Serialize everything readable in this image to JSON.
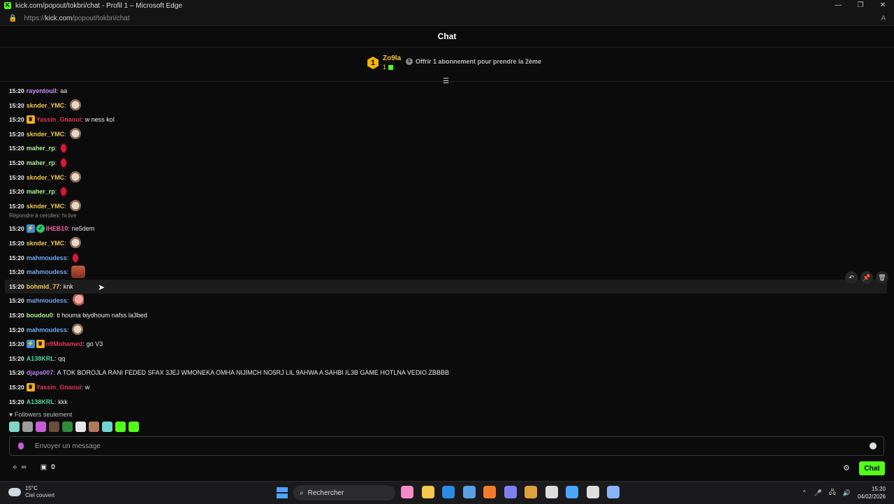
{
  "window": {
    "title": "kick.com/popout/tokbri/chat - Profil 1 – Microsoft Edge",
    "controls": [
      "—",
      "❐",
      "✕"
    ]
  },
  "address": {
    "prefix": "https://",
    "host": "kick.com",
    "path": "/popout/tokbri/chat"
  },
  "chat": {
    "title": "Chat"
  },
  "leaderboard": {
    "rank": "1",
    "user": "Zo9la",
    "count": "1",
    "offer": "Offrir 1 abonnement pour prendre la 2ème"
  },
  "messages": [
    {
      "time": "15:20",
      "user": "rayentouil",
      "color": "#d18cf2",
      "text": "aa",
      "badges": [],
      "emotes": []
    },
    {
      "time": "15:20",
      "user": "sknder_YMC",
      "color": "#f2c94c",
      "text": "",
      "badges": [],
      "emotes": [
        "cat"
      ]
    },
    {
      "time": "15:20",
      "user": "Yassin_Gnaoui",
      "color": "#e0334e",
      "text": "w ness kol",
      "badges": [
        "crown"
      ],
      "emotes": []
    },
    {
      "time": "15:20",
      "user": "sknder_YMC",
      "color": "#f2c94c",
      "text": "",
      "badges": [],
      "emotes": [
        "cat"
      ]
    },
    {
      "time": "15:20",
      "user": "maher_rp",
      "color": "#a6f28c",
      "text": "",
      "badges": [],
      "emotes": [
        "red"
      ]
    },
    {
      "time": "15:20",
      "user": "maher_rp",
      "color": "#a6f28c",
      "text": "",
      "badges": [],
      "emotes": [
        "red"
      ]
    },
    {
      "time": "15:20",
      "user": "sknder_YMC",
      "color": "#f2c94c",
      "text": "",
      "badges": [],
      "emotes": [
        "cat"
      ]
    },
    {
      "time": "15:20",
      "user": "maher_rp",
      "color": "#a6f28c",
      "text": "",
      "badges": [],
      "emotes": [
        "red"
      ]
    },
    {
      "time": "15:20",
      "user": "sknder_YMC",
      "color": "#f2c94c",
      "text": "",
      "badges": [],
      "emotes": [
        "cat"
      ]
    },
    {
      "time": "15:20",
      "user": "IHEB10",
      "color": "#f25c9b",
      "text": "ne5dem",
      "badges": [
        "blue",
        "verified"
      ],
      "emotes": [],
      "reply": "Répondre à cerollex: hi live"
    },
    {
      "time": "15:20",
      "user": "sknder_YMC",
      "color": "#f2c94c",
      "text": "",
      "badges": [],
      "emotes": [
        "cat"
      ]
    },
    {
      "time": "15:20",
      "user": "mahmoudess",
      "color": "#6ea8f2",
      "text": "",
      "badges": [],
      "emotes": [
        "red"
      ]
    },
    {
      "time": "15:20",
      "user": "mahmoudess",
      "color": "#6ea8f2",
      "text": "",
      "badges": [],
      "emotes": [
        "face"
      ]
    },
    {
      "time": "15:20",
      "user": "bohmid_77",
      "color": "#f2c94c",
      "text": "knk",
      "badges": [],
      "emotes": [],
      "highlight": true
    },
    {
      "time": "15:20",
      "user": "mahmoudess",
      "color": "#6ea8f2",
      "text": "",
      "badges": [],
      "emotes": [
        "hand"
      ]
    },
    {
      "time": "15:20",
      "user": "boudou0",
      "color": "#a6f28c",
      "text": "ti houma biydhoum nafss la3bed",
      "badges": [],
      "emotes": []
    },
    {
      "time": "15:20",
      "user": "mahmoudess",
      "color": "#6ea8f2",
      "text": "",
      "badges": [],
      "emotes": [
        "cat"
      ]
    },
    {
      "time": "15:20",
      "user": "n9Mohamed",
      "color": "#e0334e",
      "text": "go V3",
      "badges": [
        "blue",
        "crown"
      ],
      "emotes": []
    },
    {
      "time": "15:20",
      "user": "A138KRL",
      "color": "#4fd39a",
      "text": "qq",
      "badges": [],
      "emotes": []
    },
    {
      "time": "15:20",
      "user": "djapa007",
      "color": "#b47cf2",
      "text": "A TOK BOROJLA RANI FEDED SFAX 3JEJ WMONEKA OMHA NIJIMCH NO5RJ LIL 9AHWA A SAHBI IL3B GAME HOTLNA VEDIO ZBBBB",
      "badges": [],
      "emotes": []
    },
    {
      "time": "15:20",
      "user": "Yassin_Gnaoui",
      "color": "#e0334e",
      "text": "w",
      "badges": [
        "crown"
      ],
      "emotes": []
    },
    {
      "time": "15:20",
      "user": "A138KRL",
      "color": "#4fd39a",
      "text": "kkk",
      "badges": [],
      "emotes": []
    }
  ],
  "message_actions": [
    "reply-icon",
    "pin-icon",
    "delete-icon"
  ],
  "followers_only": "Followers seulement",
  "recent_emotes": [
    "#7fd6c8",
    "#9a9a9a",
    "#c85bd8",
    "#6b4d3b",
    "#2f8a3a",
    "#e6e6e6",
    "#b07a5a",
    "#6fd6d0",
    "#53fc18",
    "#53fc18"
  ],
  "input": {
    "placeholder": "Envoyer un message"
  },
  "bottom": {
    "points": "∞",
    "gifts": "0",
    "send_label": "Chat"
  },
  "taskbar": {
    "temp": "15°C",
    "weather": "Ciel couvert",
    "search": "Rechercher",
    "apps": [
      "#f28ac8",
      "#f2c94c",
      "#2a8ce0",
      "#5aa0e6",
      "#f27c2c",
      "#7f7ff2",
      "#e0a040",
      "#dddddd",
      "#4aa5ff",
      "#dddddd",
      "#8ab4f8"
    ],
    "time": "15:20",
    "date": "04/02/2026"
  }
}
